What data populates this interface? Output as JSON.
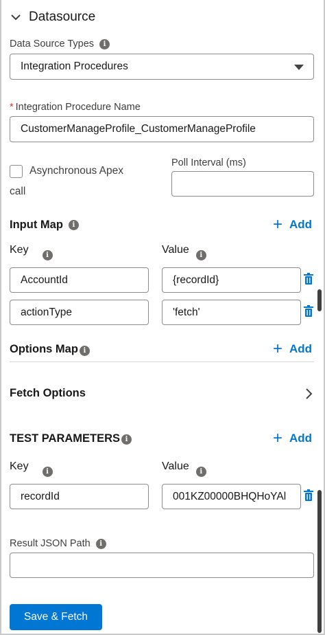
{
  "section": {
    "title": "Datasource"
  },
  "datasource_types": {
    "label": "Data Source Types",
    "value": "Integration Procedures"
  },
  "ip_name": {
    "required_mark": "*",
    "label": "Integration Procedure Name",
    "value": "CustomerManageProfile_CustomerManageProfile"
  },
  "async": {
    "label_line1": "Asynchronous Apex",
    "label_line2": "call"
  },
  "poll": {
    "label": "Poll Interval (ms)",
    "value": ""
  },
  "input_map": {
    "title": "Input Map",
    "add_label": "Add",
    "key_label": "Key",
    "value_label": "Value",
    "rows": [
      {
        "key": "AccountId",
        "value": "{recordId}"
      },
      {
        "key": "actionType",
        "value": "'fetch'"
      }
    ]
  },
  "options_map": {
    "title": "Options Map",
    "add_label": "Add"
  },
  "fetch_options": {
    "title": "Fetch Options"
  },
  "test_params": {
    "title": "TEST PARAMETERS",
    "add_label": "Add",
    "key_label": "Key",
    "value_label": "Value",
    "rows": [
      {
        "key": "recordId",
        "value": "001KZ00000BHQHoYAl"
      }
    ]
  },
  "result_json_path": {
    "label": "Result JSON Path",
    "value": ""
  },
  "save_button": {
    "label": "Save & Fetch"
  },
  "colors": {
    "brand": "#0176d3",
    "required": "#c23934",
    "border": "#8c8c8c"
  },
  "icons": [
    "chevron-down-icon",
    "info-icon",
    "caret-down-icon",
    "plus-icon",
    "trash-icon",
    "chevron-right-icon"
  ]
}
